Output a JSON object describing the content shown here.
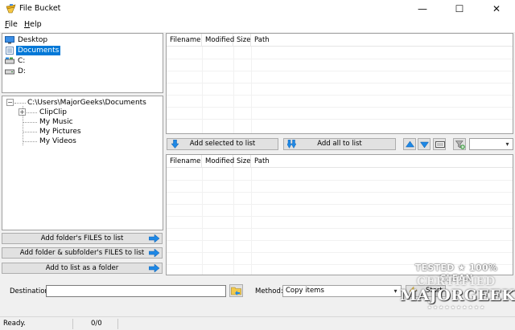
{
  "window": {
    "title": "File Bucket",
    "min_glyph": "—",
    "max_glyph": "☐",
    "close_glyph": "✕"
  },
  "menu": [
    {
      "label": "File",
      "mnemonic": "F",
      "rest": "ile"
    },
    {
      "label": "Help",
      "mnemonic": "H",
      "rest": "elp"
    }
  ],
  "drives": [
    {
      "label": "Desktop",
      "icon": "desktop-icon",
      "selected": false
    },
    {
      "label": "Documents",
      "icon": "documents-icon",
      "selected": true
    },
    {
      "label": "C:",
      "icon": "drive-icon",
      "selected": false
    },
    {
      "label": "D:",
      "icon": "drive-icon",
      "selected": false
    }
  ],
  "folder_tree": {
    "root": "C:\\Users\\MajorGeeks\\Documents",
    "root_expander": "−",
    "children": [
      {
        "label": "ClipClip",
        "expander": "+"
      },
      {
        "label": "My Music"
      },
      {
        "label": "My Pictures"
      },
      {
        "label": "My Videos"
      }
    ]
  },
  "side_buttons": [
    "Add folder's FILES to list",
    "Add folder & subfolder's FILES to list",
    "Add to list as a folder"
  ],
  "list_columns": [
    "Filename",
    "Modified",
    "Size",
    "Path"
  ],
  "middle_toolbar": {
    "add_selected": "Add selected to list",
    "add_all": "Add all to list",
    "icons": [
      "move-up-icon",
      "move-down-icon",
      "clear-list-icon",
      "filter-add-icon"
    ],
    "filter_value": ""
  },
  "bottom": {
    "destination_label": "Destination:",
    "destination_value": "",
    "method_label": "Method:",
    "method_value": "Copy items",
    "start_label": "Start"
  },
  "status": {
    "state": "Ready.",
    "count": "0/0"
  },
  "watermark": {
    "line1": "TESTED ★ 100% CLEAN",
    "line2": "CERTIFIED",
    "line3": "MAJORGEEKS",
    "line4": "★★★★★★★★★★"
  },
  "colors": {
    "selection": "#0078d7",
    "button_face": "#e1e1e1",
    "arrow_blue": "#1e88e5"
  }
}
